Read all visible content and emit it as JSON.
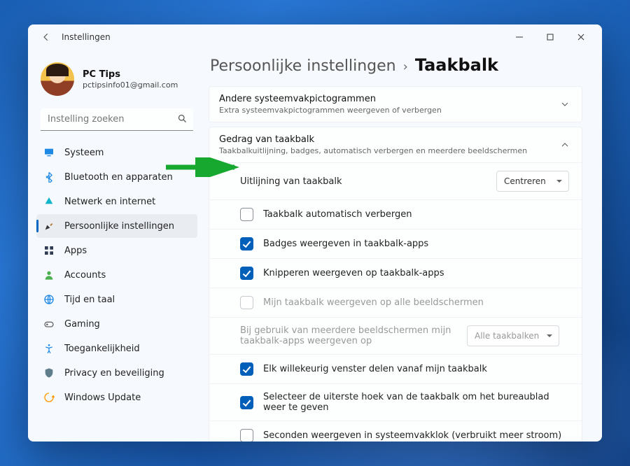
{
  "app_title": "Instellingen",
  "profile": {
    "name": "PC Tips",
    "email": "pctipsinfo01@gmail.com"
  },
  "search": {
    "placeholder": "Instelling zoeken"
  },
  "sidebar": {
    "items": [
      {
        "label": "Systeem",
        "icon": "monitor-icon",
        "color": "#1e88e5"
      },
      {
        "label": "Bluetooth en apparaten",
        "icon": "bluetooth-icon",
        "color": "#1e88e5"
      },
      {
        "label": "Netwerk en internet",
        "icon": "wifi-icon",
        "color": "#12b5cb"
      },
      {
        "label": "Persoonlijke instellingen",
        "icon": "brush-icon",
        "color": "#333",
        "active": true
      },
      {
        "label": "Apps",
        "icon": "apps-icon",
        "color": "#2f3b52"
      },
      {
        "label": "Accounts",
        "icon": "person-icon",
        "color": "#4caf50"
      },
      {
        "label": "Tijd en taal",
        "icon": "globe-icon",
        "color": "#1e88e5"
      },
      {
        "label": "Gaming",
        "icon": "gamepad-icon",
        "color": "#666"
      },
      {
        "label": "Toegankelijkheid",
        "icon": "accessibility-icon",
        "color": "#1e88e5"
      },
      {
        "label": "Privacy en beveiliging",
        "icon": "shield-icon",
        "color": "#607d8b"
      },
      {
        "label": "Windows Update",
        "icon": "update-icon",
        "color": "#ff9800"
      }
    ]
  },
  "breadcrumb": {
    "parent": "Persoonlijke instellingen",
    "leaf": "Taakbalk"
  },
  "card_other": {
    "title": "Andere systeemvakpictogrammen",
    "subtitle": "Extra systeemvakpictogrammen weergeven of verbergen"
  },
  "card_behavior": {
    "title": "Gedrag van taakbalk",
    "subtitle": "Taakbalkuitlijning, badges, automatisch verbergen en meerdere beeldschermen"
  },
  "rows": {
    "alignment": {
      "label": "Uitlijning van taakbalk",
      "value": "Centreren"
    },
    "autohide": {
      "label": "Taakbalk automatisch verbergen"
    },
    "badges": {
      "label": "Badges weergeven in taakbalk-apps"
    },
    "flashing": {
      "label": "Knipperen weergeven op taakbalk-apps"
    },
    "allmon": {
      "label": "Mijn taakbalk weergeven op alle beeldschermen"
    },
    "multi": {
      "label": "Bij gebruik van meerdere beeldschermen mijn taakbalk-apps weergeven op",
      "value": "Alle taakbalken"
    },
    "share": {
      "label": "Elk willekeurig venster delen vanaf mijn taakbalk"
    },
    "corner": {
      "label": "Selecteer de uiterste hoek van de taakbalk om het bureaublad weer te geven"
    },
    "seconds": {
      "label": "Seconden weergeven in systeemvakklok (verbruikt meer stroom)"
    }
  }
}
